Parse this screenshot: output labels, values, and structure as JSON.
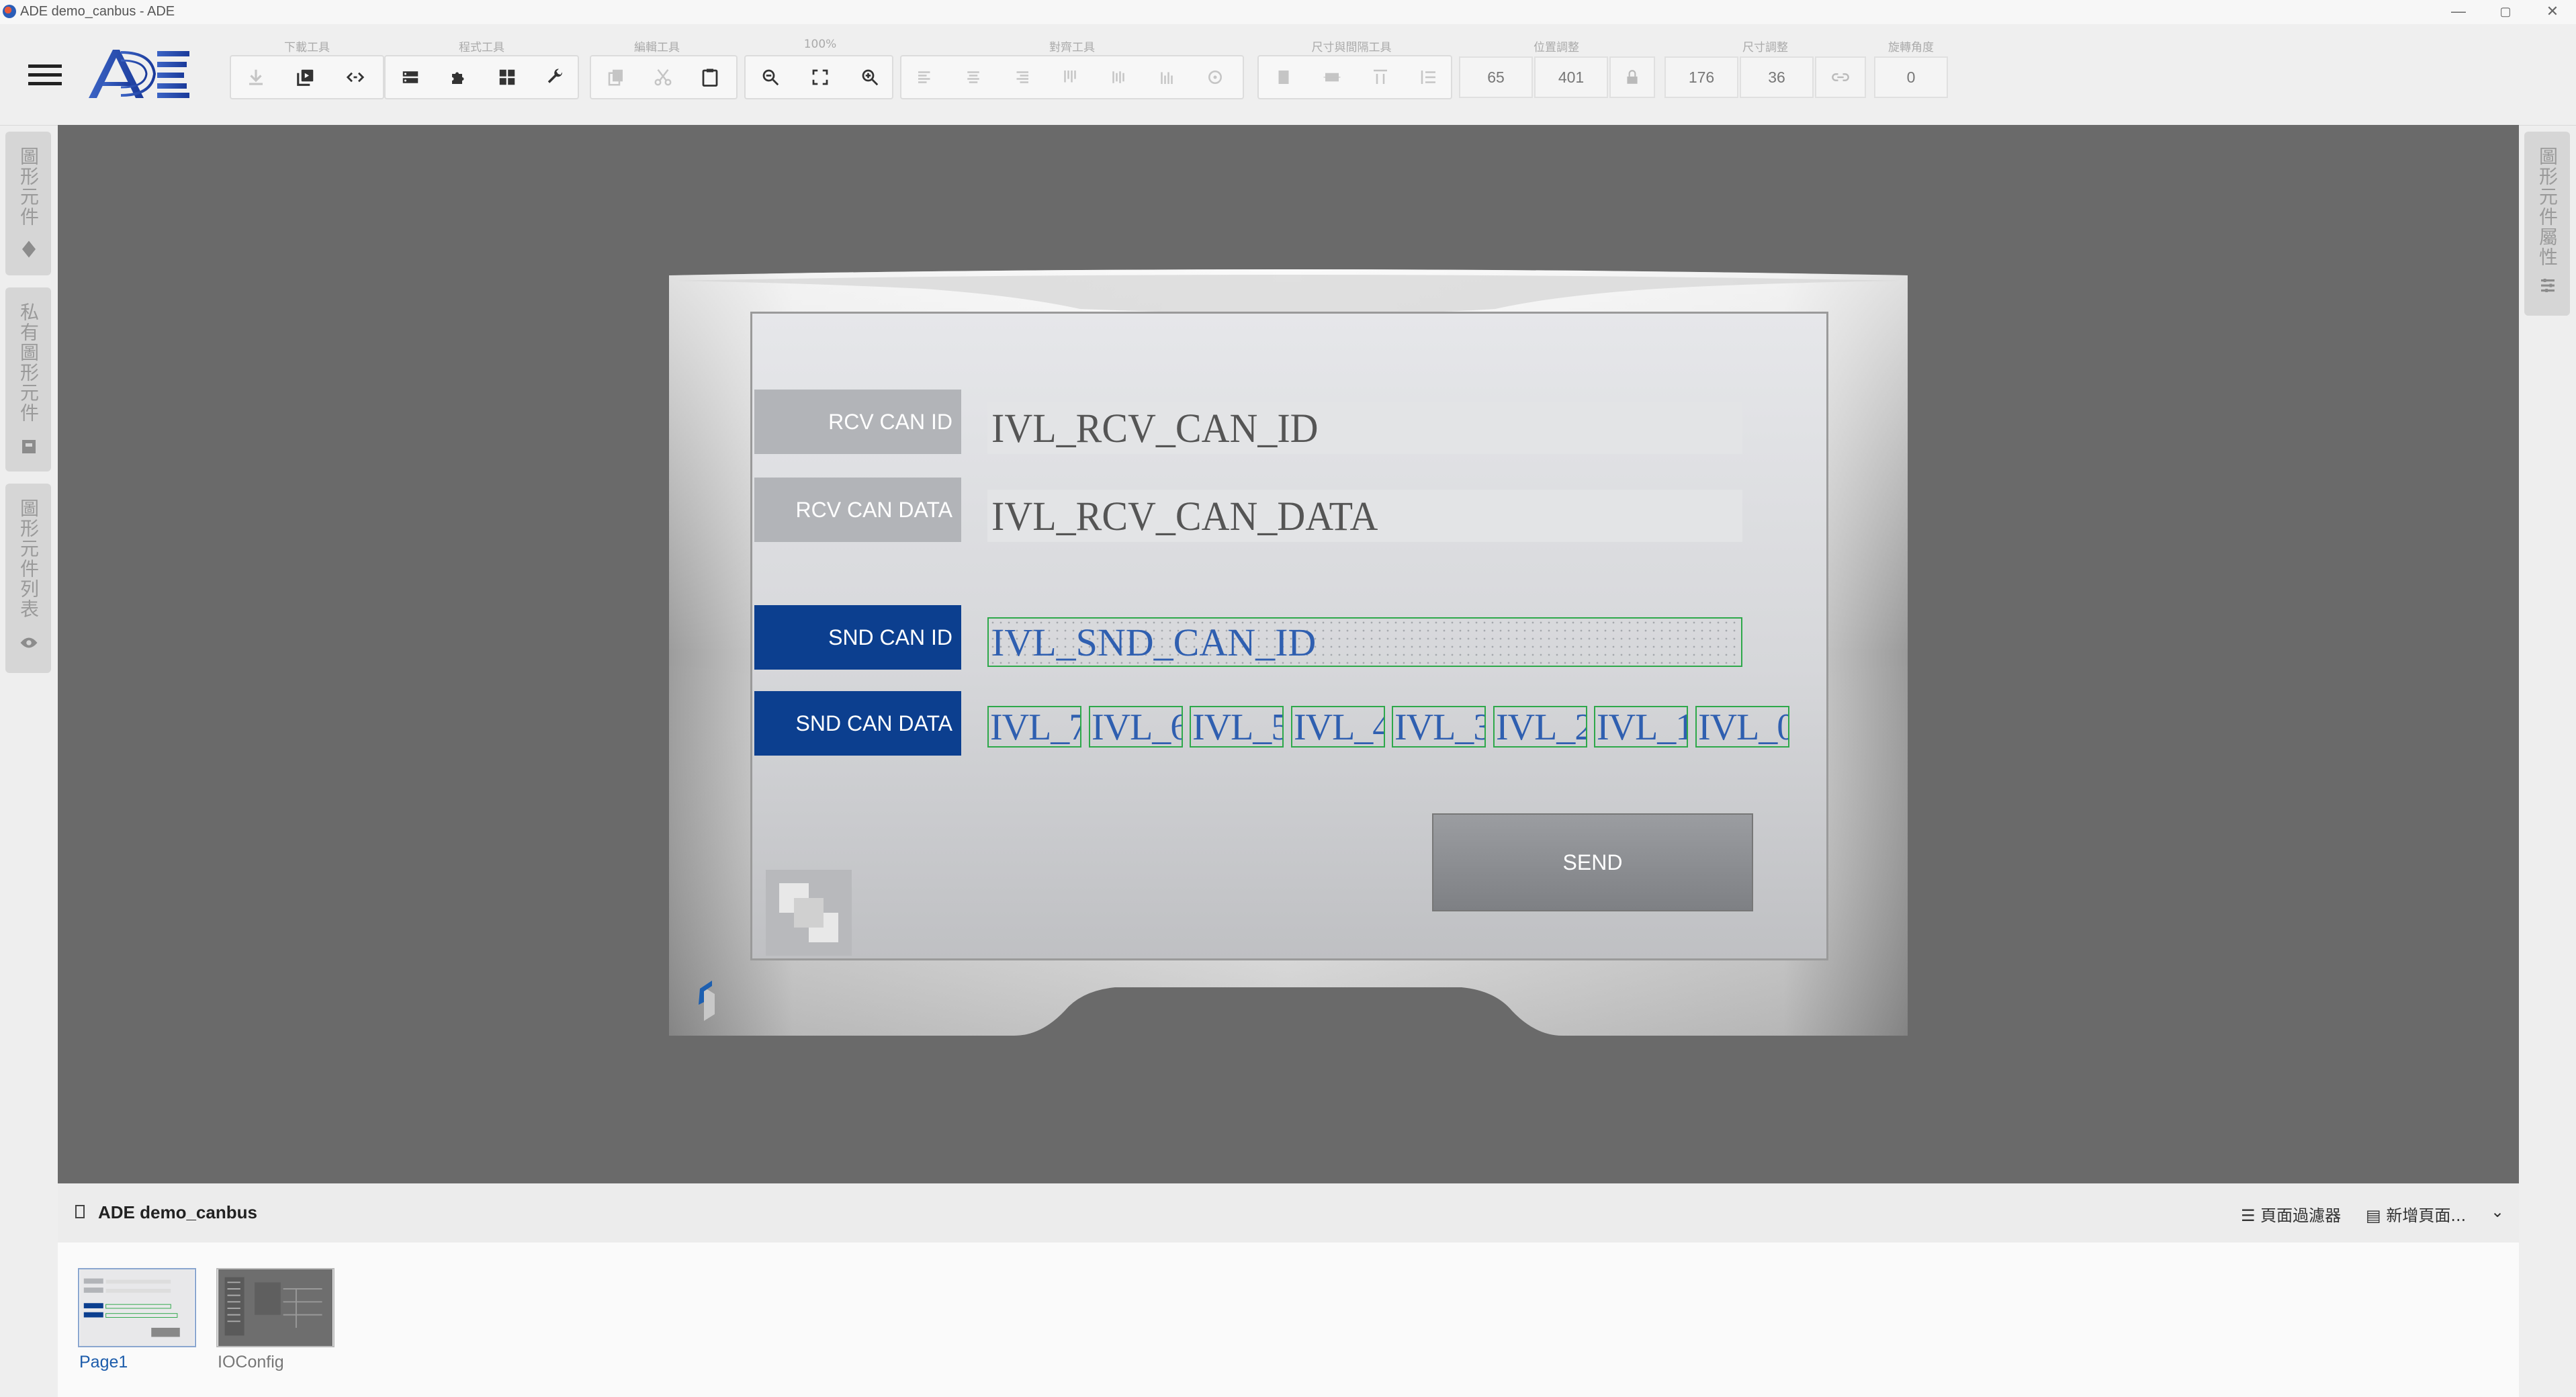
{
  "window": {
    "title": "ADE demo_canbus - ADE",
    "controls": [
      "—",
      "▢",
      "✕"
    ]
  },
  "toolbar": {
    "groups": [
      {
        "id": "download",
        "label": "下載工具"
      },
      {
        "id": "program",
        "label": "程式工具"
      },
      {
        "id": "edit",
        "label": "編輯工具"
      },
      {
        "id": "zoom",
        "label": "100%"
      },
      {
        "id": "align",
        "label": "對齊工具"
      },
      {
        "id": "spacing",
        "label": "尺寸與間隔工具"
      },
      {
        "id": "position",
        "label": "位置調整"
      },
      {
        "id": "size",
        "label": "尺寸調整"
      },
      {
        "id": "rotation",
        "label": "旋轉角度"
      }
    ],
    "position": {
      "x": "65",
      "y": "401"
    },
    "size": {
      "w": "176",
      "h": "36"
    },
    "rotation": "0"
  },
  "side_tabs": {
    "left": [
      "圖形元件",
      "私有圖形元件",
      "圖形元件列表"
    ],
    "right": [
      "圖形元件屬性"
    ]
  },
  "hmi": {
    "rows": [
      {
        "label": "RCV CAN ID",
        "value": "IVL_RCV_CAN_ID"
      },
      {
        "label": "RCV CAN DATA",
        "value": "IVL_RCV_CAN_DATA"
      },
      {
        "label": "SND CAN ID",
        "value": "IVL_SND_CAN_ID"
      },
      {
        "label": "SND CAN DATA"
      }
    ],
    "data_bytes": [
      "IVL_7",
      "IVL_6",
      "IVL_5",
      "IVL_4",
      "IVL_3",
      "IVL_2",
      "IVL_1",
      "IVL_0"
    ],
    "send_label": "SEND"
  },
  "pages": {
    "project_name": "ADE demo_canbus",
    "filter_label": "頁面過濾器",
    "new_page_label": "新增頁面...",
    "items": [
      {
        "name": "Page1",
        "selected": true
      },
      {
        "name": "IOConfig",
        "selected": false
      }
    ]
  },
  "colors": {
    "accent_blue": "#0c3f8f",
    "canvas": "#6a6a6a",
    "field_border": "#2ea84a",
    "field_text": "#2f5fb0",
    "page_link": "#1c5cab"
  }
}
